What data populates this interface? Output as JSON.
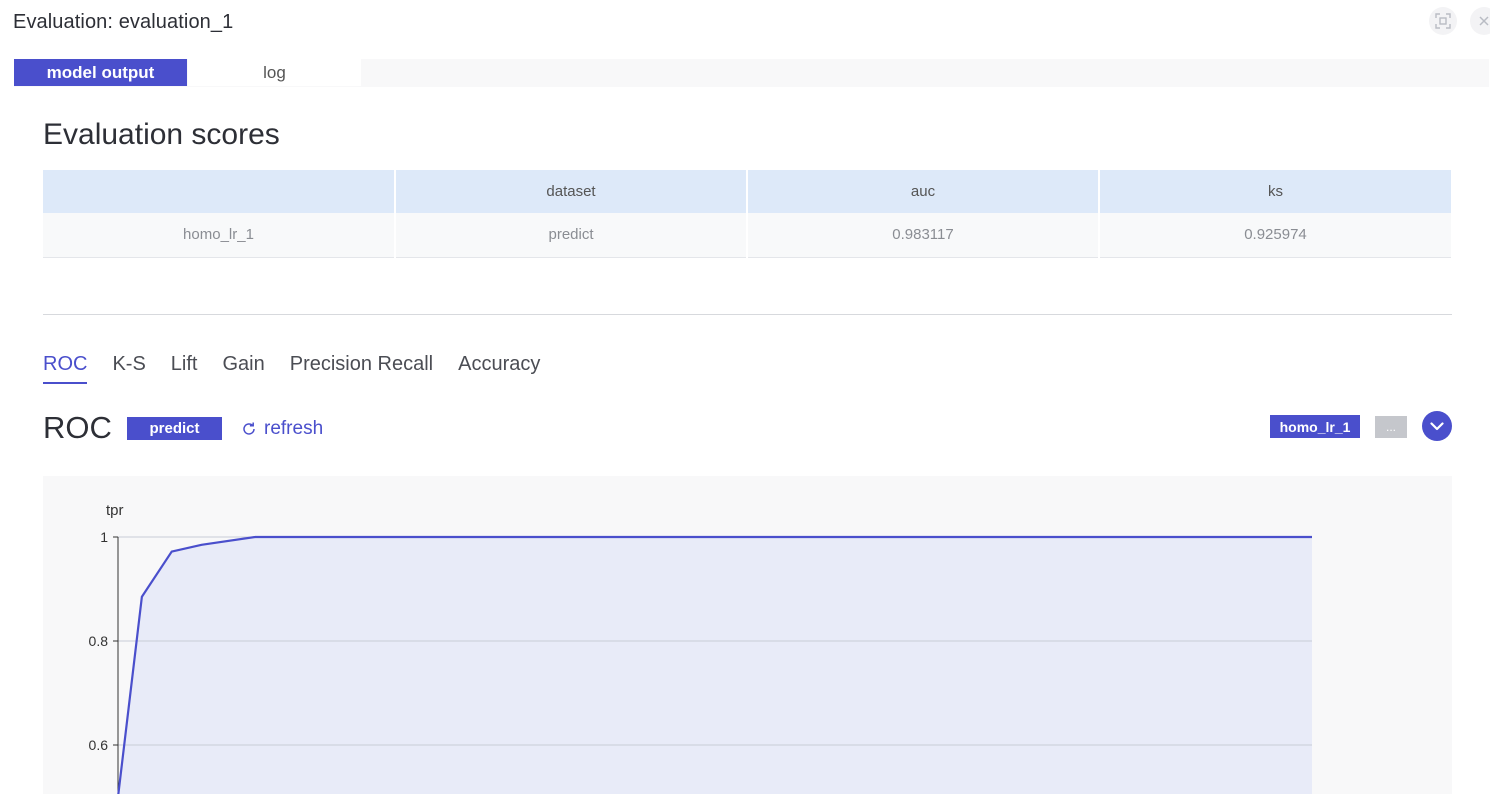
{
  "window": {
    "title": "Evaluation: evaluation_1"
  },
  "tabs": [
    {
      "label": "model output",
      "active": true
    },
    {
      "label": "log",
      "active": false
    }
  ],
  "scores": {
    "title": "Evaluation scores",
    "columns": [
      "",
      "dataset",
      "auc",
      "ks"
    ],
    "rows": [
      [
        "homo_lr_1",
        "predict",
        "0.983117",
        "0.925974"
      ]
    ]
  },
  "metric_tabs": [
    {
      "label": "ROC",
      "active": true
    },
    {
      "label": "K-S",
      "active": false
    },
    {
      "label": "Lift",
      "active": false
    },
    {
      "label": "Gain",
      "active": false
    },
    {
      "label": "Precision Recall",
      "active": false
    },
    {
      "label": "Accuracy",
      "active": false
    }
  ],
  "chart_header": {
    "title": "ROC",
    "dataset_badge": "predict",
    "refresh_label": "refresh",
    "model_badge": "homo_lr_1",
    "more_label": "..."
  },
  "colors": {
    "accent": "#4a4fcc",
    "table_header_bg": "#dde9f9",
    "area_fill": "#e8ebf8"
  },
  "chart_data": {
    "type": "area",
    "ylabel": "tpr",
    "xlabel": "",
    "ylim": [
      0.5,
      1
    ],
    "yticks": [
      1,
      0.8,
      0.6
    ],
    "ytick_labels": [
      "1",
      "0.8",
      "0.6"
    ],
    "grid": true,
    "series": [
      {
        "x": [
          0,
          0.02,
          0.045,
          0.07,
          0.115,
          1
        ],
        "y": [
          0.5,
          0.885,
          0.972,
          0.985,
          1.0,
          1.0
        ]
      }
    ]
  }
}
